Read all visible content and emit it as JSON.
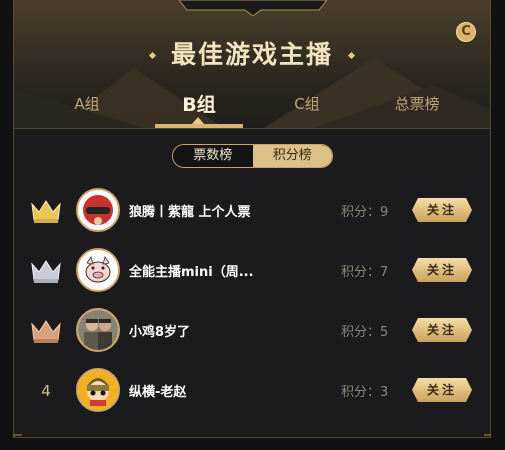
{
  "header": {
    "title": "最佳游戏主播",
    "coin_symbol": "C"
  },
  "tabs": [
    {
      "label": "A组",
      "active": false
    },
    {
      "label": "B组",
      "active": true
    },
    {
      "label": "C组",
      "active": false
    },
    {
      "label": "总票榜",
      "active": false
    }
  ],
  "toggle": {
    "votes_label": "票数榜",
    "points_label": "积分榜"
  },
  "rows": [
    {
      "rank": 1,
      "rank_display": "crown-gold",
      "name": "狼腾丨紫龍 上个人票",
      "score_label": "积分：9",
      "follow_label": "关注"
    },
    {
      "rank": 2,
      "rank_display": "crown-silver",
      "name": "全能主播mini（周...",
      "score_label": "积分：7",
      "follow_label": "关注"
    },
    {
      "rank": 3,
      "rank_display": "crown-bronze",
      "name": "小鸡8岁了",
      "score_label": "积分：5",
      "follow_label": "关注"
    },
    {
      "rank": 4,
      "rank_display": "4",
      "name": "纵横-老赵",
      "score_label": "积分：3",
      "follow_label": "关注"
    }
  ],
  "colors": {
    "accent": "#d8b46c",
    "gold": "#e8c45a",
    "silver": "#c7ccd6",
    "bronze": "#d8a07a",
    "background": "#1b1b1d"
  }
}
